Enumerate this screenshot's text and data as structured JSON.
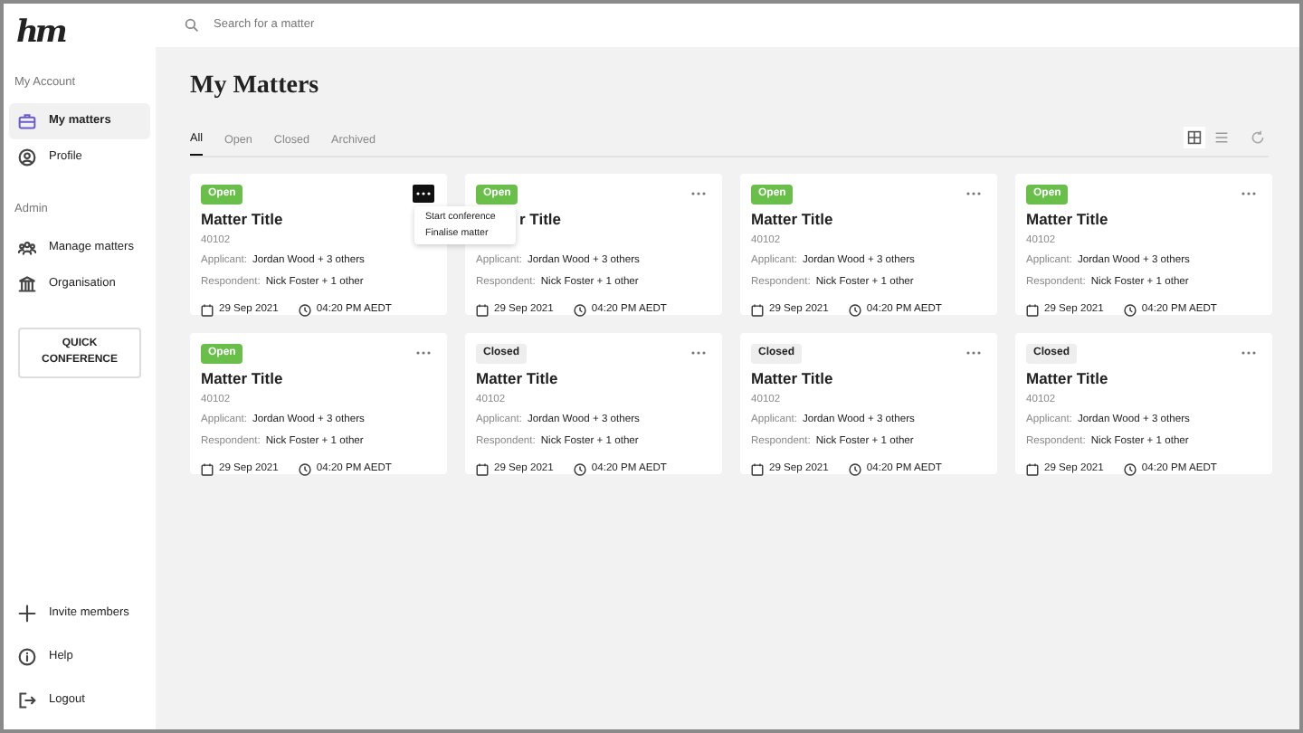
{
  "sidebar": {
    "logo": "hm",
    "sections": [
      {
        "heading": "My Account",
        "items": [
          {
            "label": "My matters",
            "selected": true
          },
          {
            "label": "Profile",
            "selected": false
          }
        ]
      },
      {
        "heading": "Admin",
        "items": [
          {
            "label": "Manage matters",
            "selected": false
          },
          {
            "label": "Organisation",
            "selected": false
          }
        ]
      }
    ],
    "action_button": "QUICK CONFERENCE",
    "footer_items": [
      {
        "label": "Invite members"
      },
      {
        "label": "Help"
      },
      {
        "label": "Logout"
      }
    ]
  },
  "search": {
    "placeholder": "Search for a matter"
  },
  "page_title": "My Matters",
  "tabs": [
    {
      "label": "All",
      "selected": true
    },
    {
      "label": "Open",
      "selected": false
    },
    {
      "label": "Closed",
      "selected": false
    },
    {
      "label": "Archived",
      "selected": false
    }
  ],
  "view_toggle": [
    {
      "kind": "grid",
      "selected": true
    },
    {
      "kind": "list",
      "selected": false
    }
  ],
  "cards": [
    {
      "status": "Open",
      "kind": "open",
      "title": "Matter Title",
      "number": "40102",
      "applicant_label": "Applicant:",
      "applicant": "Jordan Wood + 3 others",
      "respondent_label": "Respondent:",
      "respondent": "Nick Foster + 1 other",
      "date": "29 Sep 2021",
      "time": "04:20 PM AEDT",
      "menu_open": true,
      "menu": [
        "Start conference",
        "Finalise matter"
      ]
    },
    {
      "status": "Open",
      "kind": "open",
      "title": "r Title",
      "applicant_label": "Applicant:",
      "applicant": "Jordan Wood + 3 others",
      "respondent_label": "Respondent:",
      "respondent": "Nick Foster + 1 other",
      "date": "29 Sep 2021",
      "time": "04:20 PM AEDT",
      "menu_open": false
    },
    {
      "status": "Open",
      "kind": "open",
      "title": "Matter Title",
      "number": "40102",
      "applicant_label": "Applicant:",
      "applicant": "Jordan Wood + 3 others",
      "respondent_label": "Respondent:",
      "respondent": "Nick Foster + 1 other",
      "date": "29 Sep 2021",
      "time": "04:20 PM AEDT",
      "menu_open": false
    },
    {
      "status": "Open",
      "kind": "open",
      "title": "Matter Title",
      "number": "40102",
      "applicant_label": "Applicant:",
      "applicant": "Jordan Wood + 3 others",
      "respondent_label": "Respondent:",
      "respondent": "Nick Foster + 1 other",
      "date": "29 Sep 2021",
      "time": "04:20 PM AEDT",
      "menu_open": false
    },
    {
      "status": "Open",
      "kind": "open",
      "title": "Matter Title",
      "number": "40102",
      "applicant_label": "Applicant:",
      "applicant": "Jordan Wood + 3 others",
      "respondent_label": "Respondent:",
      "respondent": "Nick Foster + 1 other",
      "date": "29 Sep 2021",
      "time": "04:20 PM AEDT",
      "menu_open": false
    },
    {
      "status": "Closed",
      "kind": "closed",
      "title": "Matter Title",
      "number": "40102",
      "applicant_label": "Applicant:",
      "applicant": "Jordan Wood + 3 others",
      "respondent_label": "Respondent:",
      "respondent": "Nick Foster + 1 other",
      "date": "29 Sep 2021",
      "time": "04:20 PM AEDT",
      "menu_open": false
    },
    {
      "status": "Closed",
      "kind": "closed",
      "title": "Matter Title",
      "number": "40102",
      "applicant_label": "Applicant:",
      "applicant": "Jordan Wood + 3 others",
      "respondent_label": "Respondent:",
      "respondent": "Nick Foster + 1 other",
      "date": "29 Sep 2021",
      "time": "04:20 PM AEDT",
      "menu_open": false
    },
    {
      "status": "Closed",
      "kind": "closed",
      "title": "Matter Title",
      "number": "40102",
      "applicant_label": "Applicant:",
      "applicant": "Jordan Wood + 3 others",
      "respondent_label": "Respondent:",
      "respondent": "Nick Foster + 1 other",
      "date": "29 Sep 2021",
      "time": "04:20 PM AEDT",
      "menu_open": false
    }
  ]
}
